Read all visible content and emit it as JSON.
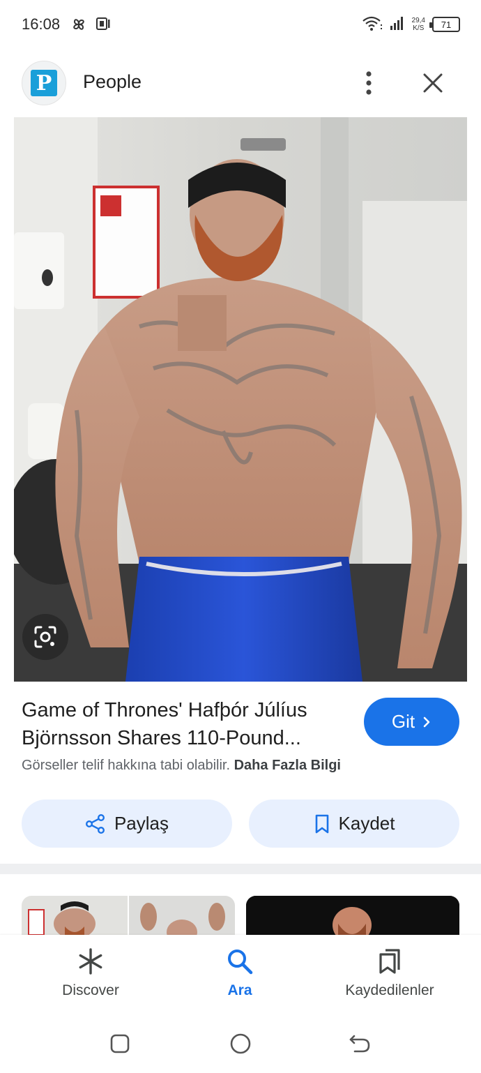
{
  "status_bar": {
    "time": "16:08",
    "net_speed_value": "29,4",
    "net_speed_unit": "K/S",
    "battery": "71"
  },
  "header": {
    "favicon_letter": "P",
    "site_name": "People"
  },
  "result": {
    "title": "Game of Thrones' Hafþór Júlíus Björnsson Shares 110-Pound...",
    "go_label": "Git",
    "copyright_notice": "Görseller telif hakkına tabi olabilir.",
    "learn_more": "Daha Fazla Bilgi",
    "share_label": "Paylaş",
    "save_label": "Kaydet"
  },
  "bottom_nav": {
    "items": [
      {
        "label": "Discover",
        "icon": "asterisk-icon",
        "active": false
      },
      {
        "label": "Ara",
        "icon": "search-icon",
        "active": true
      },
      {
        "label": "Kaydedilenler",
        "icon": "bookmarks-icon",
        "active": false
      }
    ]
  },
  "colors": {
    "accent": "#1a73e8",
    "pill_bg": "#e8f0fe",
    "favicon_bg": "#1a9fd9"
  }
}
